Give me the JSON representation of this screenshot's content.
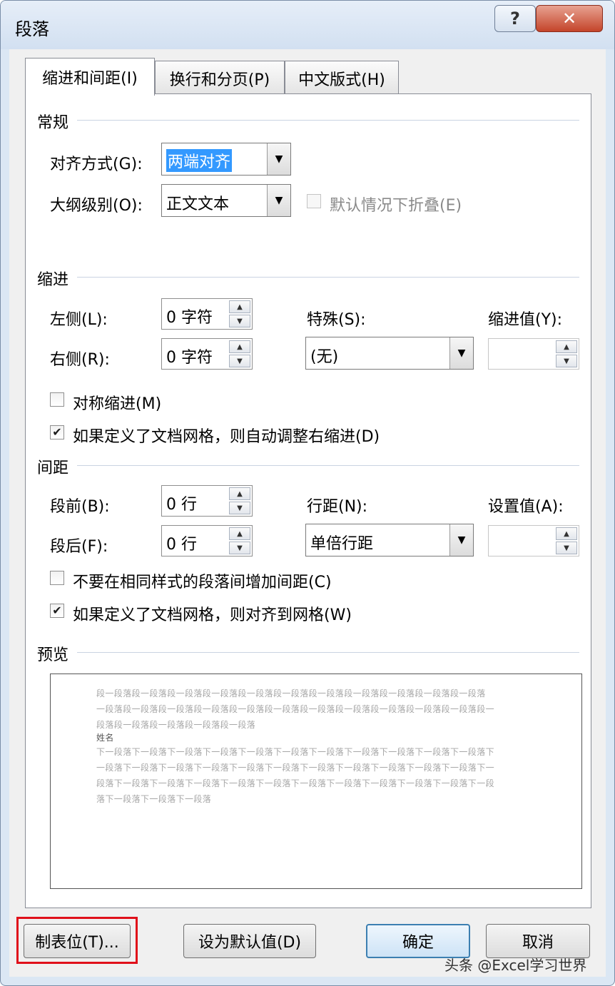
{
  "window": {
    "title": "段落",
    "help_label": "?",
    "close_label": "✕"
  },
  "tabs": [
    {
      "label": "缩进和间距(I)",
      "active": true
    },
    {
      "label": "换行和分页(P)",
      "active": false
    },
    {
      "label": "中文版式(H)",
      "active": false
    }
  ],
  "general": {
    "section_label": "常规",
    "alignment_label": "对齐方式(G):",
    "alignment_value": "两端对齐",
    "outline_label": "大纲级别(O):",
    "outline_value": "正文文本",
    "collapse_label": "默认情况下折叠(E)",
    "collapse_checked": false
  },
  "indent": {
    "section_label": "缩进",
    "left_label": "左侧(L):",
    "left_value": "0 字符",
    "right_label": "右侧(R):",
    "right_value": "0 字符",
    "special_label": "特殊(S):",
    "special_value": "(无)",
    "by_label": "缩进值(Y):",
    "by_value": "",
    "mirror_label": "对称缩进(M)",
    "mirror_checked": false,
    "auto_right_label": "如果定义了文档网格，则自动调整右缩进(D)",
    "auto_right_checked": true
  },
  "spacing": {
    "section_label": "间距",
    "before_label": "段前(B):",
    "before_value": "0 行",
    "after_label": "段后(F):",
    "after_value": "0 行",
    "line_label": "行距(N):",
    "line_value": "单倍行距",
    "at_label": "设置值(A):",
    "at_value": "",
    "no_space_label": "不要在相同样式的段落间增加间距(C)",
    "no_space_checked": false,
    "snap_grid_label": "如果定义了文档网格，则对齐到网格(W)",
    "snap_grid_checked": true
  },
  "preview": {
    "section_label": "预览",
    "prev_lines": [
      "段一段落段一段落段一段落段一段落段一段落段一段落段一段落段一段落段一段落段一段落段一段落",
      "一段落段一段落段一段落段一段落段一段落段一段落段一段落段一段落段一段落段一段落段一段落段一",
      "段落段一段落段一段落段一段落段一段落"
    ],
    "current_text": "姓名",
    "next_lines": [
      "下一段落下一段落下一段落下一段落下一段落下一段落下一段落下一段落下一段落下一段落下一段落下",
      "一段落下一段落下一段落下一段落下一段落下一段落下一段落下一段落下一段落下一段落下一段落下一",
      "段落下一段落下一段落下一段落下一段落下一段落下一段落下一段落下一段落下一段落下一段落下一段",
      "落下一段落下一段落下一段落"
    ]
  },
  "buttons": {
    "tabs_label": "制表位(T)...",
    "set_default_label": "设为默认值(D)",
    "ok_label": "确定",
    "cancel_label": "取消"
  },
  "watermark": "头条 @Excel学习世界",
  "highlight_color": "#e0101a",
  "selection_color": "#3399ff"
}
